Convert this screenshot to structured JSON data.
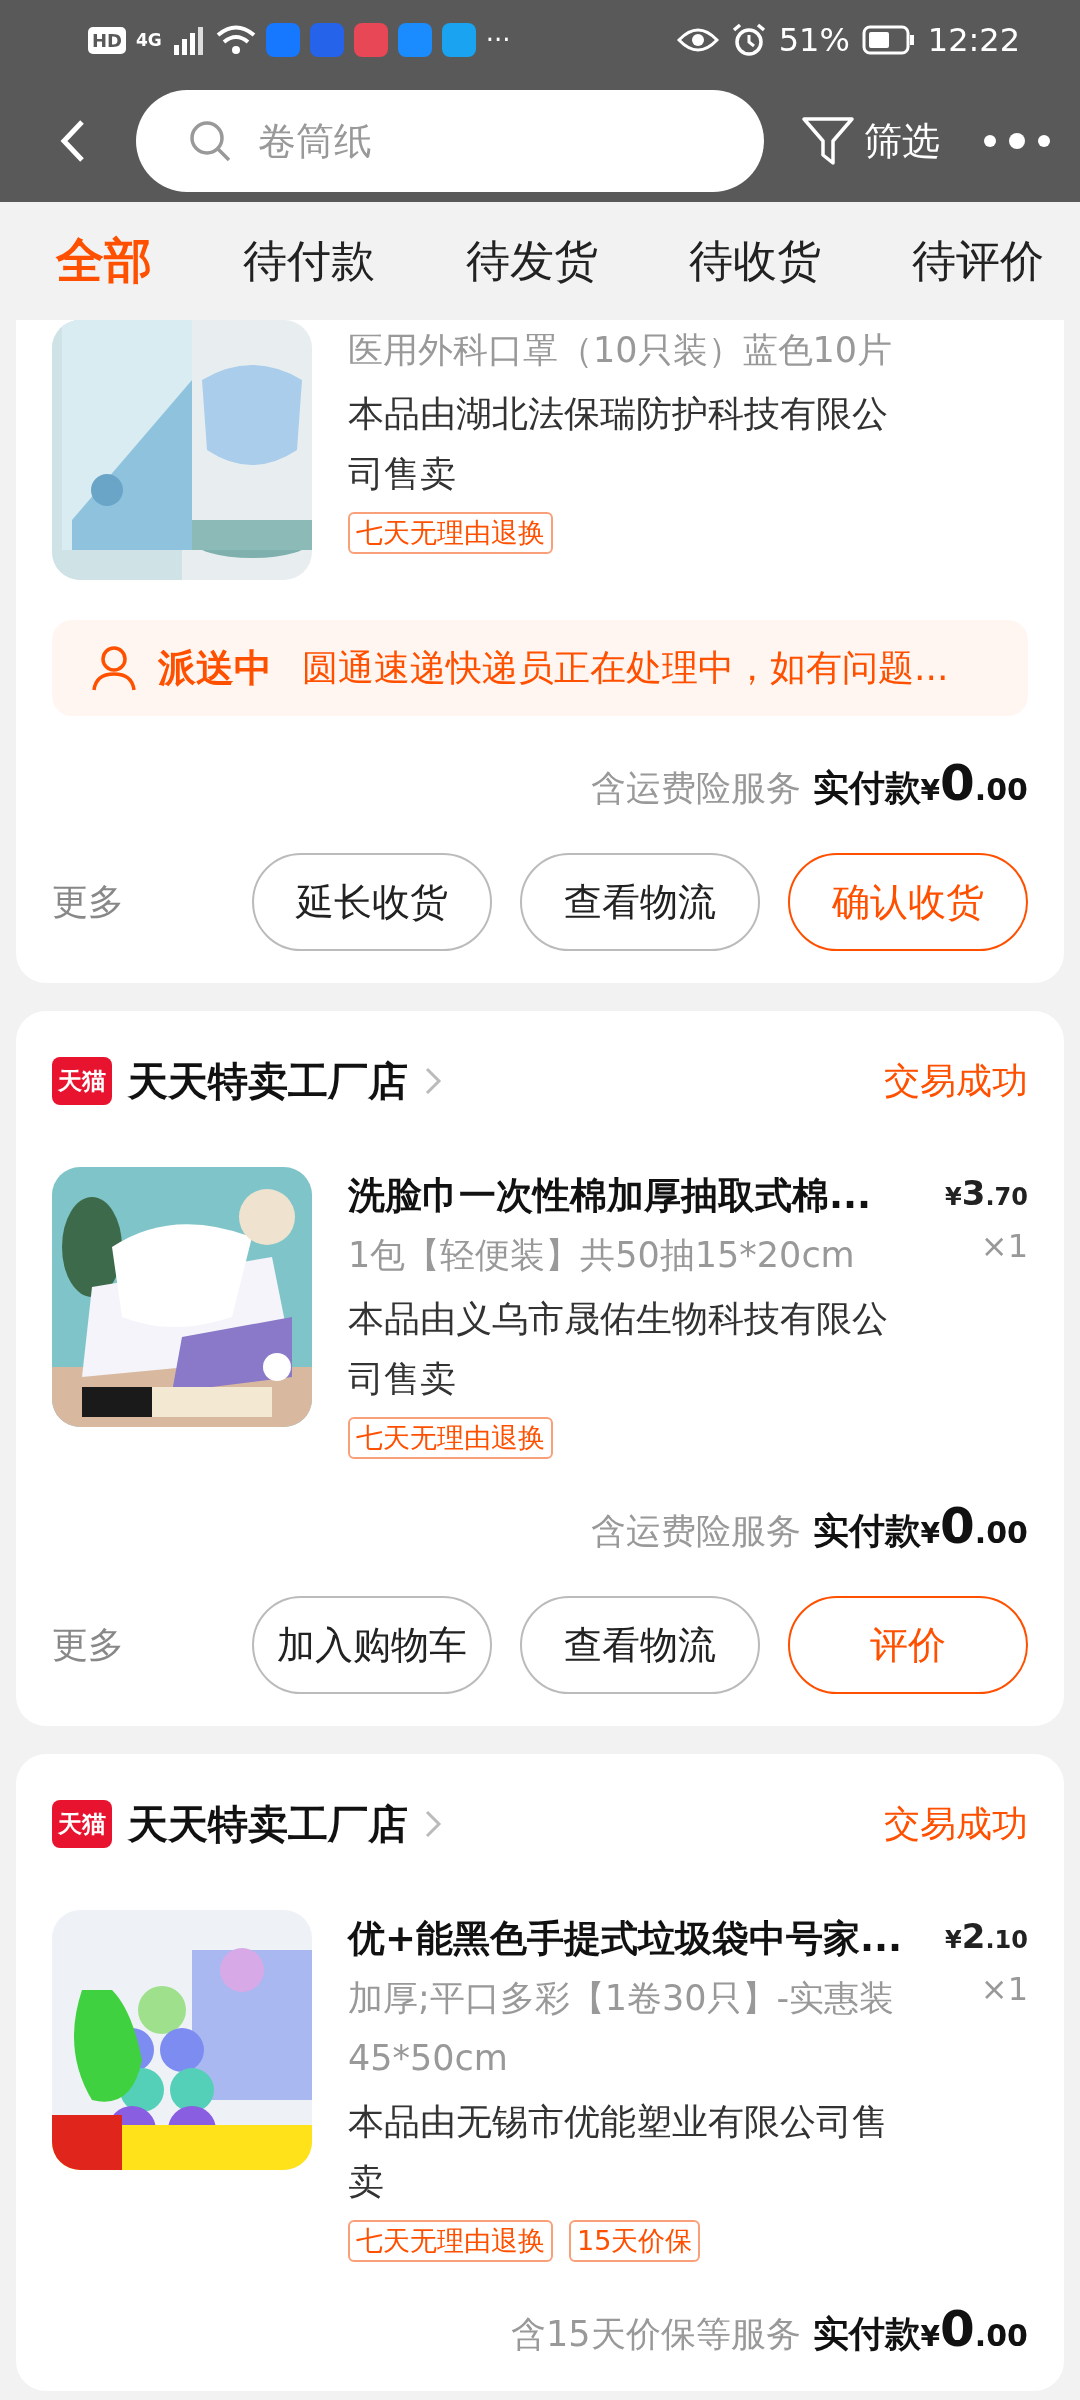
{
  "status_bar": {
    "hd": "HD",
    "network": "4G",
    "more": "···",
    "battery": "51%",
    "time": "12:22"
  },
  "search": {
    "placeholder": "卷筒纸"
  },
  "filter": {
    "label": "筛选"
  },
  "tabs": [
    {
      "label": "全部",
      "selected": true
    },
    {
      "label": "待付款",
      "selected": false
    },
    {
      "label": "待发货",
      "selected": false
    },
    {
      "label": "待收货",
      "selected": false
    },
    {
      "label": "待评价",
      "selected": false
    }
  ],
  "orders": [
    {
      "item": {
        "spec": "医用外科口罩（10只装）蓝色10片",
        "seller": "本品由湖北法保瑞防护科技有限公司售卖",
        "tags": [
          "七天无理由退换"
        ]
      },
      "notice": {
        "status": "派送中",
        "message": "圆通速递快递员正在处理中，如有问题..."
      },
      "service_note": "含运费险服务",
      "paid_label": "实付款",
      "paid": {
        "currency": "¥",
        "integer": "0",
        "fraction": ".00"
      },
      "more": "更多",
      "actions": [
        {
          "label": "延长收货",
          "kind": "normal"
        },
        {
          "label": "查看物流",
          "kind": "normal"
        },
        {
          "label": "确认收货",
          "kind": "primary"
        }
      ]
    },
    {
      "store": {
        "logo": "天猫",
        "name": "天天特卖工厂店"
      },
      "status": "交易成功",
      "item": {
        "title": "洗脸巾一次性棉加厚抽取式棉...",
        "spec": "1包【轻便装】共50抽15*20cm",
        "seller": "本品由义乌市晟佑生物科技有限公司售卖",
        "tags": [
          "七天无理由退换"
        ],
        "price": {
          "currency": "¥",
          "integer": "3",
          "fraction": ".70"
        },
        "quantity": "×1"
      },
      "service_note": "含运费险服务",
      "paid_label": "实付款",
      "paid": {
        "currency": "¥",
        "integer": "0",
        "fraction": ".00"
      },
      "more": "更多",
      "actions": [
        {
          "label": "加入购物车",
          "kind": "normal"
        },
        {
          "label": "查看物流",
          "kind": "normal"
        },
        {
          "label": "评价",
          "kind": "primary"
        }
      ]
    },
    {
      "store": {
        "logo": "天猫",
        "name": "天天特卖工厂店"
      },
      "status": "交易成功",
      "item": {
        "title": "优+能黑色手提式垃圾袋中号家...",
        "spec": "加厚;平口多彩【1卷30只】-实惠装45*50cm",
        "seller": "本品由无锡市优能塑业有限公司售卖",
        "tags": [
          "七天无理由退换",
          "15天价保"
        ],
        "price": {
          "currency": "¥",
          "integer": "2",
          "fraction": ".10"
        },
        "quantity": "×1"
      },
      "service_note": "含15天价保等服务",
      "paid_label": "实付款",
      "paid": {
        "currency": "¥",
        "integer": "0",
        "fraction": ".00"
      }
    }
  ]
}
